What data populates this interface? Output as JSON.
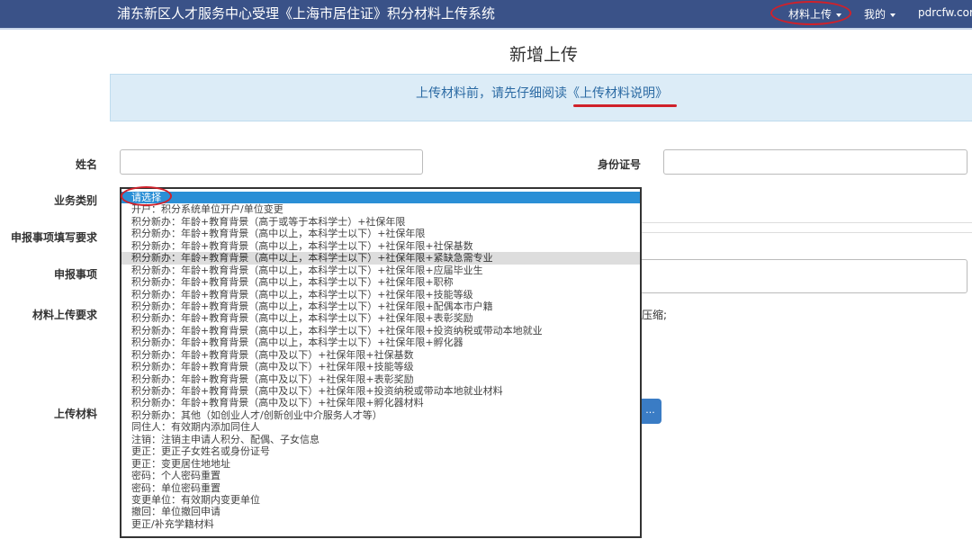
{
  "nav": {
    "brand": "浦东新区人才服务中心受理《上海市居住证》积分材料上传系统",
    "upload": "材料上传",
    "mine": "我的",
    "site": "pdrcfw.com"
  },
  "page_title": "新增上传",
  "notice": {
    "prefix": "上传材料前，请先仔细阅读",
    "link": "《上传材料说明》"
  },
  "form": {
    "name_label": "姓名",
    "id_label": "身份证号",
    "category_label": "业务类别",
    "fill_req_label": "申报事项填写要求",
    "item_label": "申报事项",
    "material_req_label": "材料上传要求",
    "material_req_tail": "压缩;",
    "upload_label": "上传材料",
    "browse": "..."
  },
  "options": [
    "请选择",
    "开户：积分系统单位开户/单位变更",
    "积分新办：年龄+教育背景（高于或等于本科学士）+社保年限",
    "积分新办：年龄+教育背景（高中以上，本科学士以下）+社保年限",
    "积分新办：年龄+教育背景（高中以上，本科学士以下）+社保年限+社保基数",
    "积分新办：年龄+教育背景（高中以上，本科学士以下）+社保年限+紧缺急需专业",
    "积分新办：年龄+教育背景（高中以上，本科学士以下）+社保年限+应届毕业生",
    "积分新办：年龄+教育背景（高中以上，本科学士以下）+社保年限+职称",
    "积分新办：年龄+教育背景（高中以上，本科学士以下）+社保年限+技能等级",
    "积分新办：年龄+教育背景（高中以上，本科学士以下）+社保年限+配偶本市户籍",
    "积分新办：年龄+教育背景（高中以上，本科学士以下）+社保年限+表彰奖励",
    "积分新办：年龄+教育背景（高中以上，本科学士以下）+社保年限+投资纳税或带动本地就业",
    "积分新办：年龄+教育背景（高中以上，本科学士以下）+社保年限+孵化器",
    "积分新办：年龄+教育背景（高中及以下）+社保年限+社保基数",
    "积分新办：年龄+教育背景（高中及以下）+社保年限+技能等级",
    "积分新办：年龄+教育背景（高中及以下）+社保年限+表彰奖励",
    "积分新办：年龄+教育背景（高中及以下）+社保年限+投资纳税或带动本地就业材料",
    "积分新办：年龄+教育背景（高中及以下）+社保年限+孵化器材料",
    "积分新办：其他（如创业人才/创新创业中介服务人才等）",
    "同住人：有效期内添加同住人",
    "注销：注销主申请人积分、配偶、子女信息",
    "更正：更正子女姓名或身份证号",
    "更正：变更居住地地址",
    "密码：个人密码重置",
    "密码：单位密码重置",
    "变更单位：有效期内变更单位",
    "撤回：单位撤回申请",
    "更正/补充学籍材料"
  ]
}
